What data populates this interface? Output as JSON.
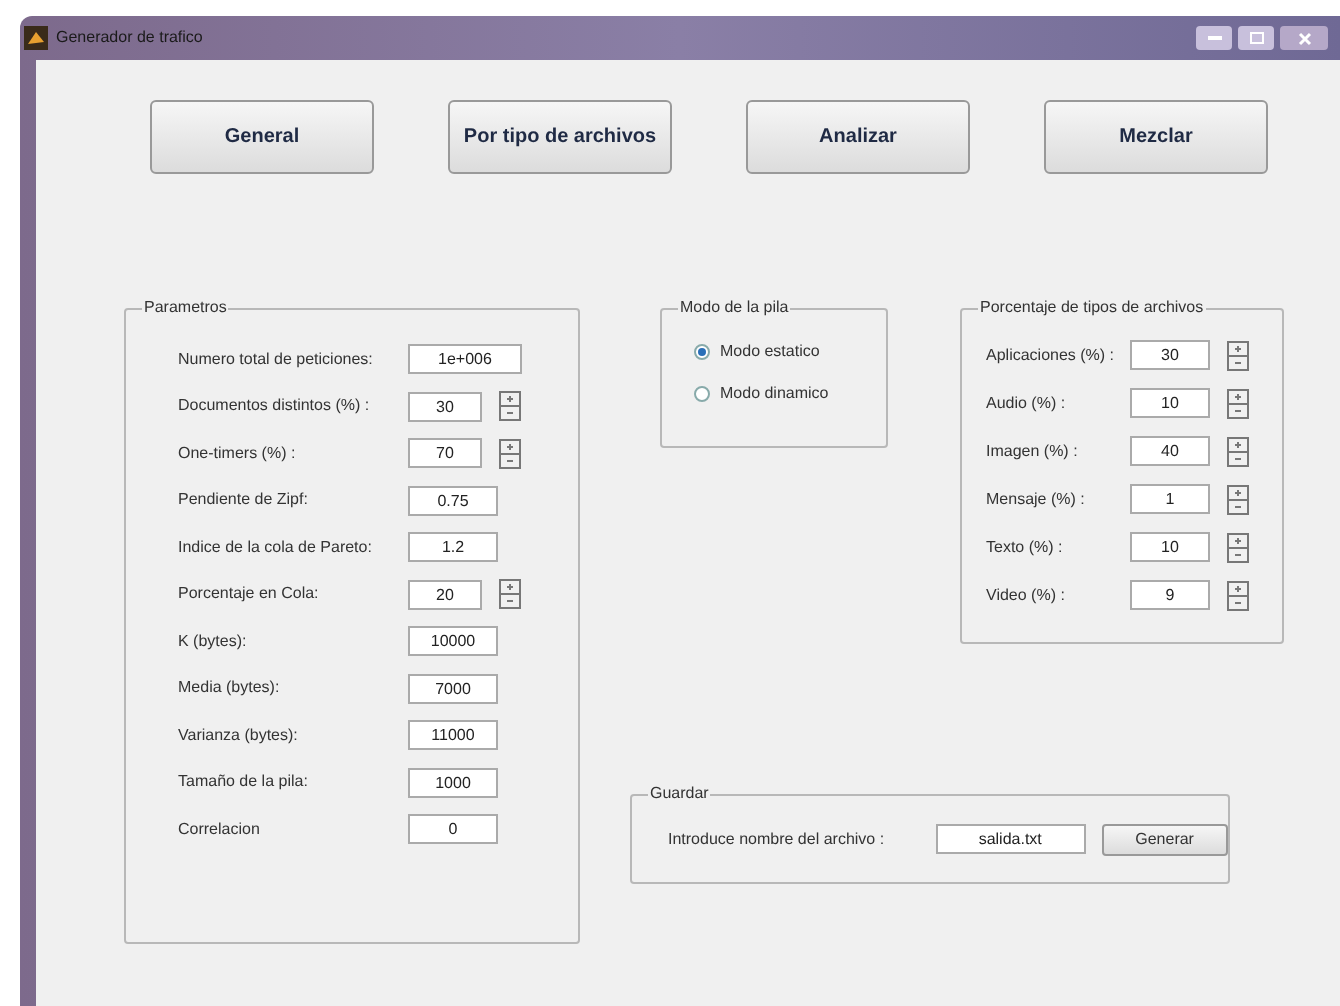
{
  "window": {
    "title": "Generador de trafico"
  },
  "buttons": [
    "General",
    "Por tipo de archivos",
    "Analizar",
    "Mezclar"
  ],
  "parametros": {
    "title": "Parametros",
    "rows": [
      {
        "label": "Numero total de peticiones:",
        "value": "1e+006",
        "kind": "plain"
      },
      {
        "label": "Documentos distintos (%) :",
        "value": "30",
        "kind": "spin"
      },
      {
        "label": "One-timers (%) :",
        "value": "70",
        "kind": "spin"
      },
      {
        "label": "Pendiente de Zipf:",
        "value": "0.75",
        "kind": "plain"
      },
      {
        "label": "Indice de la cola de Pareto:",
        "value": "1.2",
        "kind": "plain"
      },
      {
        "label": "Porcentaje en Cola:",
        "value": "20",
        "kind": "spin"
      },
      {
        "label": "K (bytes):",
        "value": "10000",
        "kind": "plain"
      },
      {
        "label": "Media (bytes):",
        "value": "7000",
        "kind": "plain"
      },
      {
        "label": "Varianza (bytes):",
        "value": "11000",
        "kind": "plain"
      },
      {
        "label": "Tamaño de la pila:",
        "value": "1000",
        "kind": "plain"
      },
      {
        "label": "Correlacion",
        "value": "0",
        "kind": "plain"
      }
    ]
  },
  "modo": {
    "title": "Modo de la pila",
    "options": [
      {
        "label": "Modo estatico",
        "selected": true
      },
      {
        "label": "Modo dinamico",
        "selected": false
      }
    ]
  },
  "porcentaje": {
    "title": "Porcentaje de tipos de archivos",
    "rows": [
      {
        "label": "Aplicaciones (%) :",
        "value": "30"
      },
      {
        "label": "Audio (%) :",
        "value": "10"
      },
      {
        "label": "Imagen (%) :",
        "value": "40"
      },
      {
        "label": "Mensaje (%) :",
        "value": "1"
      },
      {
        "label": "Texto (%) :",
        "value": "10"
      },
      {
        "label": "Video (%) :",
        "value": "9"
      }
    ]
  },
  "guardar": {
    "title": "Guardar",
    "label": "Introduce nombre del archivo :",
    "value": "salida.txt",
    "button": "Generar"
  }
}
